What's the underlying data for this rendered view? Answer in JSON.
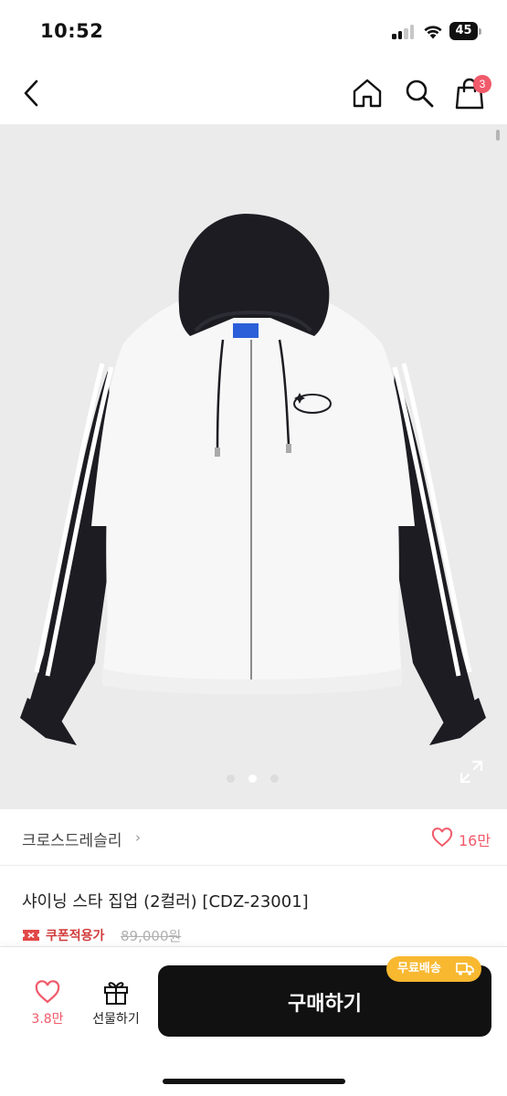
{
  "status_bar": {
    "time": "10:52",
    "battery": "45"
  },
  "header": {
    "back_icon": "chevron-left-icon",
    "home_icon": "home-icon",
    "search_icon": "search-icon",
    "cart_icon": "shopping-bag-icon",
    "cart_badge": "3",
    "badge_color": "#f05a6a"
  },
  "gallery": {
    "image_count": 3,
    "active_index": 1,
    "expand_icon": "expand-icon"
  },
  "brand": {
    "name": "크로스드레슬리",
    "chevron": "›",
    "like_count": "16만",
    "like_icon": "heart-icon"
  },
  "product": {
    "title": "샤이닝 스타 집업 (2컬러) [CDZ-23001]",
    "coupon_label": "쿠폰적용가",
    "original_price": "89,000원"
  },
  "bottom_bar": {
    "wish_count": "3.8만",
    "gift_label": "선물하기",
    "buy_label": "구매하기",
    "shipping_badge": "무료배송",
    "accent_color": "#f05a6a",
    "badge_color": "#f8b830"
  }
}
